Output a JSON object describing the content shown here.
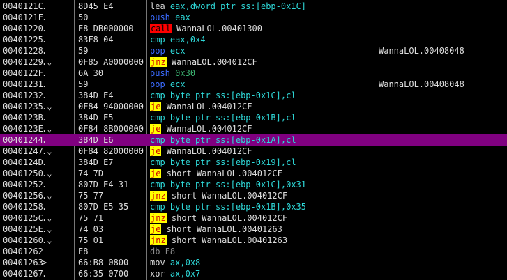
{
  "colors": {
    "background": "#000000",
    "selection": "#800080",
    "call_bg": "#ff0000",
    "jump_bg": "#ffff00",
    "cyan": "#2ed8d8",
    "blue": "#3a6bff"
  },
  "rows": [
    {
      "addr": "0040121C",
      "mark": ".",
      "hex": "8D45 E4",
      "mnem": "lea",
      "mclass": "mnem-plain",
      "ops": "eax,dword ptr ss:[ebp-0x1C]",
      "oclass": "op-mem",
      "cmt": ""
    },
    {
      "addr": "0040121F",
      "mark": ".",
      "hex": "50",
      "mnem": "push",
      "mclass": "mnem-push",
      "ops": "eax",
      "oclass": "op-reg",
      "cmt": ""
    },
    {
      "addr": "00401220",
      "mark": ".",
      "hex": "E8 DB000000",
      "mnem": "call",
      "mclass": "mnem-call",
      "ops": "WannaLOL.00401300",
      "oclass": "op-sym",
      "cmt": ""
    },
    {
      "addr": "00401225",
      "mark": ".",
      "hex": "83F8 04",
      "mnem": "cmp",
      "mclass": "mnem-cmp",
      "ops": "eax,0x4",
      "oclass": "op-mem",
      "cmt": ""
    },
    {
      "addr": "00401228",
      "mark": ".",
      "hex": "59",
      "mnem": "pop",
      "mclass": "mnem-pop",
      "ops": "ecx",
      "oclass": "op-reg",
      "cmt": "WannaLOL.00408048"
    },
    {
      "addr": "00401229",
      "mark": ".v",
      "hex": "0F85 A0000000",
      "mnem": "jnz",
      "mclass": "mnem-jcc",
      "ops": "WannaLOL.004012CF",
      "oclass": "op-sym",
      "cmt": ""
    },
    {
      "addr": "0040122F",
      "mark": ".",
      "hex": "6A 30",
      "mnem": "push",
      "mclass": "mnem-push",
      "ops": "0x30",
      "oclass": "op-numg",
      "cmt": ""
    },
    {
      "addr": "00401231",
      "mark": ".",
      "hex": "59",
      "mnem": "pop",
      "mclass": "mnem-pop",
      "ops": "ecx",
      "oclass": "op-reg",
      "cmt": "WannaLOL.00408048"
    },
    {
      "addr": "00401232",
      "mark": ".",
      "hex": "384D E4",
      "mnem": "cmp",
      "mclass": "mnem-cmp",
      "ops": "byte ptr ss:[ebp-0x1C],cl",
      "oclass": "op-mem",
      "cmt": ""
    },
    {
      "addr": "00401235",
      "mark": ".v",
      "hex": "0F84 94000000",
      "mnem": "je",
      "mclass": "mnem-jcc",
      "ops": "WannaLOL.004012CF",
      "oclass": "op-sym",
      "cmt": ""
    },
    {
      "addr": "0040123B",
      "mark": ".",
      "hex": "384D E5",
      "mnem": "cmp",
      "mclass": "mnem-cmp",
      "ops": "byte ptr ss:[ebp-0x1B],cl",
      "oclass": "op-mem",
      "cmt": ""
    },
    {
      "addr": "0040123E",
      "mark": ".v",
      "hex": "0F84 8B000000",
      "mnem": "je",
      "mclass": "mnem-jcc",
      "ops": "WannaLOL.004012CF",
      "oclass": "op-sym",
      "cmt": ""
    },
    {
      "addr": "00401244",
      "mark": ".",
      "hex": "384D E6",
      "mnem": "cmp",
      "mclass": "mnem-cmp",
      "ops": "byte ptr ss:[ebp-0x1A],cl",
      "oclass": "op-mem",
      "cmt": "",
      "selected": true
    },
    {
      "addr": "00401247",
      "mark": ".v",
      "hex": "0F84 82000000",
      "mnem": "je",
      "mclass": "mnem-jcc",
      "ops": "WannaLOL.004012CF",
      "oclass": "op-sym",
      "cmt": ""
    },
    {
      "addr": "0040124D",
      "mark": ".",
      "hex": "384D E7",
      "mnem": "cmp",
      "mclass": "mnem-cmp",
      "ops": "byte ptr ss:[ebp-0x19],cl",
      "oclass": "op-mem",
      "cmt": ""
    },
    {
      "addr": "00401250",
      "mark": ".v",
      "hex": "74 7D",
      "mnem": "je",
      "mclass": "mnem-jcc",
      "ops": "short WannaLOL.004012CF",
      "oclass": "op-sym",
      "cmt": ""
    },
    {
      "addr": "00401252",
      "mark": ".",
      "hex": "807D E4 31",
      "mnem": "cmp",
      "mclass": "mnem-cmp",
      "ops": "byte ptr ss:[ebp-0x1C],0x31",
      "oclass": "op-mem",
      "cmt": ""
    },
    {
      "addr": "00401256",
      "mark": ".v",
      "hex": "75 77",
      "mnem": "jnz",
      "mclass": "mnem-jcc",
      "ops": "short WannaLOL.004012CF",
      "oclass": "op-sym",
      "cmt": ""
    },
    {
      "addr": "00401258",
      "mark": ".",
      "hex": "807D E5 35",
      "mnem": "cmp",
      "mclass": "mnem-cmp",
      "ops": "byte ptr ss:[ebp-0x1B],0x35",
      "oclass": "op-mem",
      "cmt": ""
    },
    {
      "addr": "0040125C",
      "mark": ".v",
      "hex": "75 71",
      "mnem": "jnz",
      "mclass": "mnem-jcc",
      "ops": "short WannaLOL.004012CF",
      "oclass": "op-sym",
      "cmt": ""
    },
    {
      "addr": "0040125E",
      "mark": ".v",
      "hex": "74 03",
      "mnem": "je",
      "mclass": "mnem-jcc",
      "ops": "short WannaLOL.00401263",
      "oclass": "op-sym",
      "cmt": ""
    },
    {
      "addr": "00401260",
      "mark": ".v",
      "hex": "75 01",
      "mnem": "jnz",
      "mclass": "mnem-jcc",
      "ops": "short WannaLOL.00401263",
      "oclass": "op-sym",
      "cmt": ""
    },
    {
      "addr": "00401262",
      "mark": "",
      "hex": "E8",
      "mnem": "db",
      "mclass": "mnem-db",
      "ops": "E8",
      "oclass": "mnem-db",
      "cmt": ""
    },
    {
      "addr": "00401263",
      "mark": ">",
      "hex": "66:B8 0800",
      "mnem": "mov",
      "mclass": "mnem-plain",
      "ops": "ax,0x8",
      "oclass": "op-mem",
      "cmt": ""
    },
    {
      "addr": "00401267",
      "mark": ".",
      "hex": "66:35 0700",
      "mnem": "xor",
      "mclass": "mnem-plain",
      "ops": "ax,0x7",
      "oclass": "op-mem",
      "cmt": ""
    }
  ]
}
